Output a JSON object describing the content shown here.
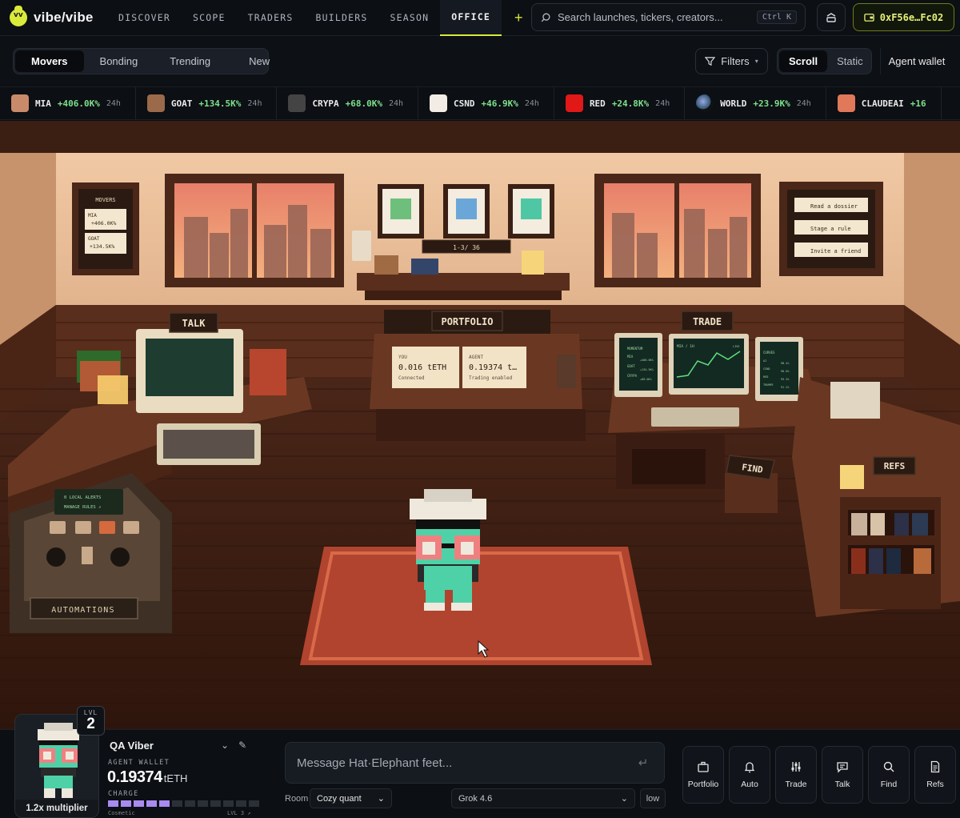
{
  "brand": {
    "name": "vibe/vibe"
  },
  "nav": {
    "links": [
      "DISCOVER",
      "SCOPE",
      "TRADERS",
      "BUILDERS",
      "SEASON",
      "OFFICE"
    ],
    "active": "OFFICE",
    "plus_label": "+"
  },
  "search": {
    "placeholder": "Search launches, tickers, creators...",
    "shortcut": "Ctrl K"
  },
  "wallet": {
    "address": "0xF56e…Fc02"
  },
  "subbar": {
    "segments": [
      "Movers",
      "Bonding",
      "Trending",
      "New"
    ],
    "active_segment": "Movers",
    "filters_label": "Filters",
    "scroll_options": [
      "Scroll",
      "Static"
    ],
    "active_scroll": "Scroll",
    "agent_wallet_label": "Agent wallet"
  },
  "ticker": [
    {
      "symbol": "MIA",
      "change": "+406.0K%",
      "period": "24h",
      "color": "#c98a6a"
    },
    {
      "symbol": "GOAT",
      "change": "+134.5K%",
      "period": "24h",
      "color": "#9a6a4a"
    },
    {
      "symbol": "CRYPA",
      "change": "+68.0K%",
      "period": "24h",
      "color": "#3a3a3a"
    },
    {
      "symbol": "CSND",
      "change": "+46.9K%",
      "period": "24h",
      "color": "#f2ece4"
    },
    {
      "symbol": "RED",
      "change": "+24.8K%",
      "period": "24h",
      "color": "#e01818"
    },
    {
      "symbol": "WORLD",
      "change": "+23.9K%",
      "period": "24h",
      "color": "#1a1a1a"
    },
    {
      "symbol": "CLAUDEAI",
      "change": "+16",
      "period": "",
      "color": "#e0785a"
    }
  ],
  "scene": {
    "movers_board": {
      "title": "MOVERS",
      "items": [
        {
          "symbol": "MIA",
          "change": "+406.0K%"
        },
        {
          "symbol": "GOAT",
          "change": "+134.5K%"
        }
      ]
    },
    "pager": "1-3/ 36",
    "dossier_menu": [
      "Read a dossier",
      "Stage a rule",
      "Invite a friend"
    ],
    "stations": [
      "TALK",
      "PORTFOLIO",
      "TRADE",
      "FIND",
      "REFS",
      "AUTOMATIONS"
    ],
    "portfolio": {
      "you": {
        "label": "YOU",
        "value": "0.016 tETH",
        "status": "Connected"
      },
      "agent": {
        "label": "AGENT",
        "value": "0.19374 t…",
        "status": "Trading enabled"
      }
    },
    "automation_screen": [
      "0 LOCAL ALERTS",
      "MANAGE RULES ↗"
    ],
    "trade_screen": {
      "left": {
        "title": "MOMENTUM",
        "rows": [
          "MIA",
          "GOAT",
          "CRYPA"
        ],
        "values": [
          "+406.0K%",
          "+134.5K%",
          "+68.0K%"
        ]
      },
      "center": {
        "title": "MIA / 1H",
        "tag": "LIVE"
      },
      "right": {
        "title": "CURVES",
        "rows": [
          "AI",
          "CSND",
          "RED",
          "TRUMPE"
        ],
        "values": [
          "98.4%",
          "96.0%",
          "93.3%",
          "91.2%"
        ]
      }
    }
  },
  "player": {
    "level_label": "LVL",
    "level": "2",
    "multiplier": "1.2x multiplier",
    "name": "QA Viber",
    "wallet_label": "AGENT WALLET",
    "wallet_value": "0.19374",
    "wallet_unit": "tETH",
    "charge_label": "CHARGE",
    "charge_filled": 5,
    "charge_total": 12,
    "cosmetic_label": "Cosmetic",
    "next_level": "LVL 3 ↗"
  },
  "composer": {
    "placeholder": "Message Hat·Elephant feet...",
    "room_label": "Room",
    "room_value": "Cozy quant",
    "model_value": "Grok 4.6",
    "effort_value": "low"
  },
  "actions": [
    {
      "label": "Portfolio",
      "icon": "briefcase-icon"
    },
    {
      "label": "Auto",
      "icon": "bell-icon"
    },
    {
      "label": "Trade",
      "icon": "sliders-icon"
    },
    {
      "label": "Talk",
      "icon": "chat-icon"
    },
    {
      "label": "Find",
      "icon": "search-icon"
    },
    {
      "label": "Refs",
      "icon": "document-icon"
    }
  ],
  "colors": {
    "accent": "#d9ea3b",
    "positive": "#7ee08c",
    "charge": "#a98bf0"
  }
}
